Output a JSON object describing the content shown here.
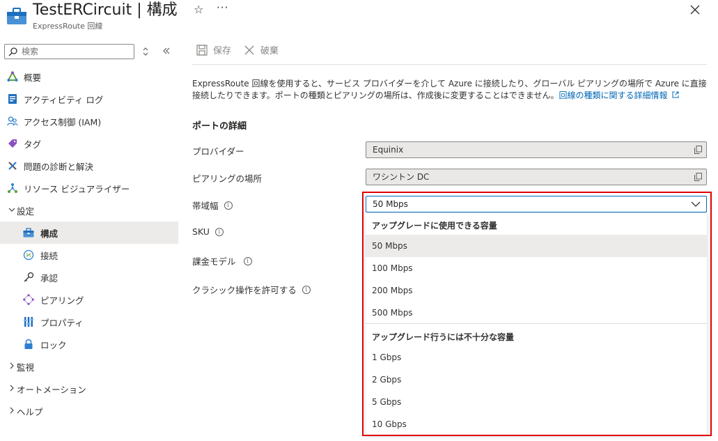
{
  "header": {
    "title": "TestERCircuit | 構成",
    "subtitle": "ExpressRoute 回線",
    "more": "···"
  },
  "search": {
    "placeholder": "検索"
  },
  "nav": {
    "items": [
      {
        "label": "概要",
        "icon": "overview-triangle-icon"
      },
      {
        "label": "アクティビティ ログ",
        "icon": "activity-log-icon"
      },
      {
        "label": "アクセス制御 (IAM)",
        "icon": "people-icon"
      },
      {
        "label": "タグ",
        "icon": "tag-icon"
      },
      {
        "label": "問題の診断と解決",
        "icon": "wrench-icon"
      },
      {
        "label": "リソース ビジュアライザー",
        "icon": "network-icon"
      }
    ],
    "settings_label": "設定",
    "settings_items": [
      {
        "label": "構成",
        "icon": "configuration-icon"
      },
      {
        "label": "接続",
        "icon": "connection-icon"
      },
      {
        "label": "承認",
        "icon": "key-icon"
      },
      {
        "label": "ピアリング",
        "icon": "peering-icon"
      },
      {
        "label": "プロパティ",
        "icon": "properties-icon"
      },
      {
        "label": "ロック",
        "icon": "lock-icon"
      }
    ],
    "collapsed": [
      {
        "label": "監視"
      },
      {
        "label": "オートメーション"
      },
      {
        "label": "ヘルプ"
      }
    ]
  },
  "toolbar": {
    "save_label": "保存",
    "discard_label": "破棄"
  },
  "description": {
    "text": "ExpressRoute 回線を使用すると、サービス プロバイダーを介して Azure に接続したり、グローバル ピアリングの場所で Azure に直接接続したりできます。ポートの種類とピアリングの場所は、作成後に変更することはできません。",
    "link": "回線の種類に関する詳細情報"
  },
  "port_details": {
    "heading": "ポートの詳細",
    "provider_label": "プロバイダー",
    "provider_value": "Equinix",
    "peering_label": "ピアリングの場所",
    "peering_value": "ワシントン DC",
    "bandwidth_label": "帯域幅",
    "sku_label": "SKU",
    "billing_label": "課金モデル",
    "classic_label": "クラシック操作を許可する"
  },
  "bandwidth_dropdown": {
    "selected": "50 Mbps",
    "group1_header": "アップグレードに使用できる容量",
    "group1_options": [
      "50 Mbps",
      "100 Mbps",
      "200 Mbps",
      "500 Mbps"
    ],
    "group2_header": "アップグレード行うには不十分な容量",
    "group2_options": [
      "1 Gbps",
      "2 Gbps",
      "5 Gbps",
      "10 Gbps"
    ]
  },
  "colors": {
    "accent": "#0067b8",
    "highlight": "#e00000"
  }
}
